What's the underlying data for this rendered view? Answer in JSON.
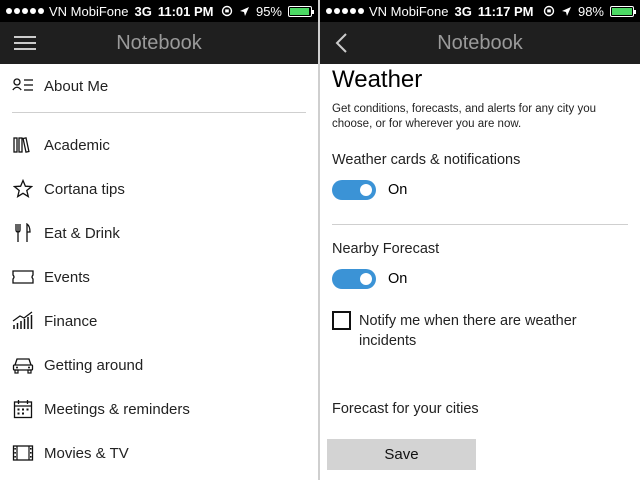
{
  "left": {
    "status": {
      "carrier": "VN MobiFone",
      "network": "3G",
      "time": "11:01 PM",
      "battery": "95%",
      "battery_level": 0.95
    },
    "header": {
      "title": "Notebook"
    },
    "items": [
      {
        "label": "About Me",
        "icon": "person-list-icon"
      },
      {
        "label": "Academic",
        "icon": "books-icon"
      },
      {
        "label": "Cortana tips",
        "icon": "star-icon"
      },
      {
        "label": "Eat & Drink",
        "icon": "fork-knife-icon"
      },
      {
        "label": "Events",
        "icon": "ticket-icon"
      },
      {
        "label": "Finance",
        "icon": "chart-icon"
      },
      {
        "label": "Getting around",
        "icon": "car-icon"
      },
      {
        "label": "Meetings & reminders",
        "icon": "calendar-icon"
      },
      {
        "label": "Movies & TV",
        "icon": "film-icon"
      }
    ]
  },
  "right": {
    "status": {
      "carrier": "VN MobiFone",
      "network": "3G",
      "time": "11:17 PM",
      "battery": "98%",
      "battery_level": 0.98
    },
    "header": {
      "title": "Notebook"
    },
    "title": "Weather",
    "description": "Get conditions, forecasts, and alerts for any city you choose, or for wherever you are now.",
    "cards_label": "Weather cards & notifications",
    "cards_toggle": "On",
    "nearby_label": "Nearby Forecast",
    "nearby_toggle": "On",
    "notify_label": "Notify me when there are weather incidents",
    "cities_label": "Forecast for your cities",
    "save_label": "Save"
  }
}
